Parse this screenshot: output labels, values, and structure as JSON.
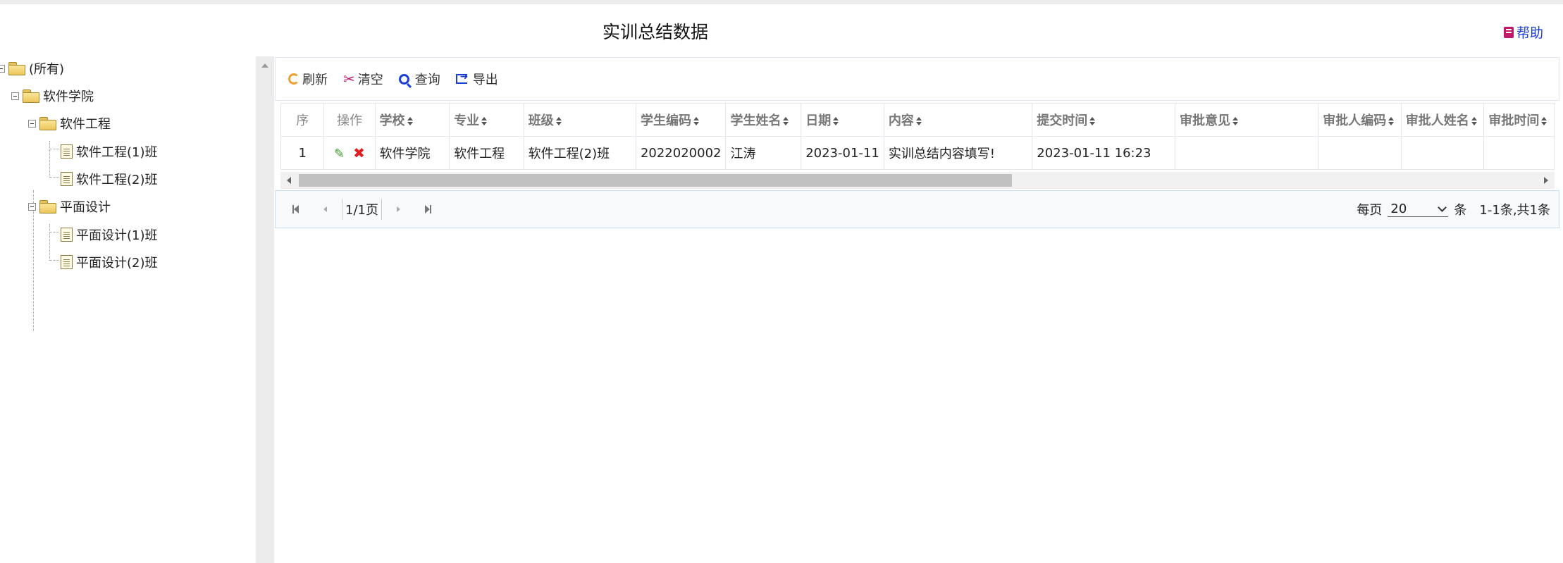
{
  "header": {
    "title": "实训总结数据",
    "help": "帮助"
  },
  "tree": {
    "root": "(所有)",
    "school": "软件学院",
    "major1": "软件工程",
    "class1": "软件工程(1)班",
    "class2": "软件工程(2)班",
    "major2": "平面设计",
    "class3": "平面设计(1)班",
    "class4": "平面设计(2)班"
  },
  "toolbar": {
    "refresh": "刷新",
    "clear": "清空",
    "query": "查询",
    "export": "导出"
  },
  "table": {
    "headers": [
      "序",
      "操作",
      "学校",
      "专业",
      "班级",
      "学生编码",
      "学生姓名",
      "日期",
      "内容",
      "提交时间",
      "审批意见",
      "审批人编码",
      "审批人姓名",
      "审批时间"
    ],
    "rows": [
      [
        "1",
        "",
        "软件学院",
        "软件工程",
        "软件工程(2)班",
        "2022020002",
        "江涛",
        "2023-01-11",
        "实训总结内容填写!",
        "2023-01-11 16:23",
        "",
        "",
        "",
        ""
      ]
    ]
  },
  "pager": {
    "page_info": "1/1页",
    "per_page_label": "每页",
    "per_page": "20",
    "unit": "条",
    "summary": "1-1条,共1条"
  },
  "colors": {
    "accent": "#1a3fd9",
    "help_icon": "#c0186a",
    "edit": "#3a9a2a",
    "delete": "#e02020",
    "refresh": "#f0a030"
  }
}
